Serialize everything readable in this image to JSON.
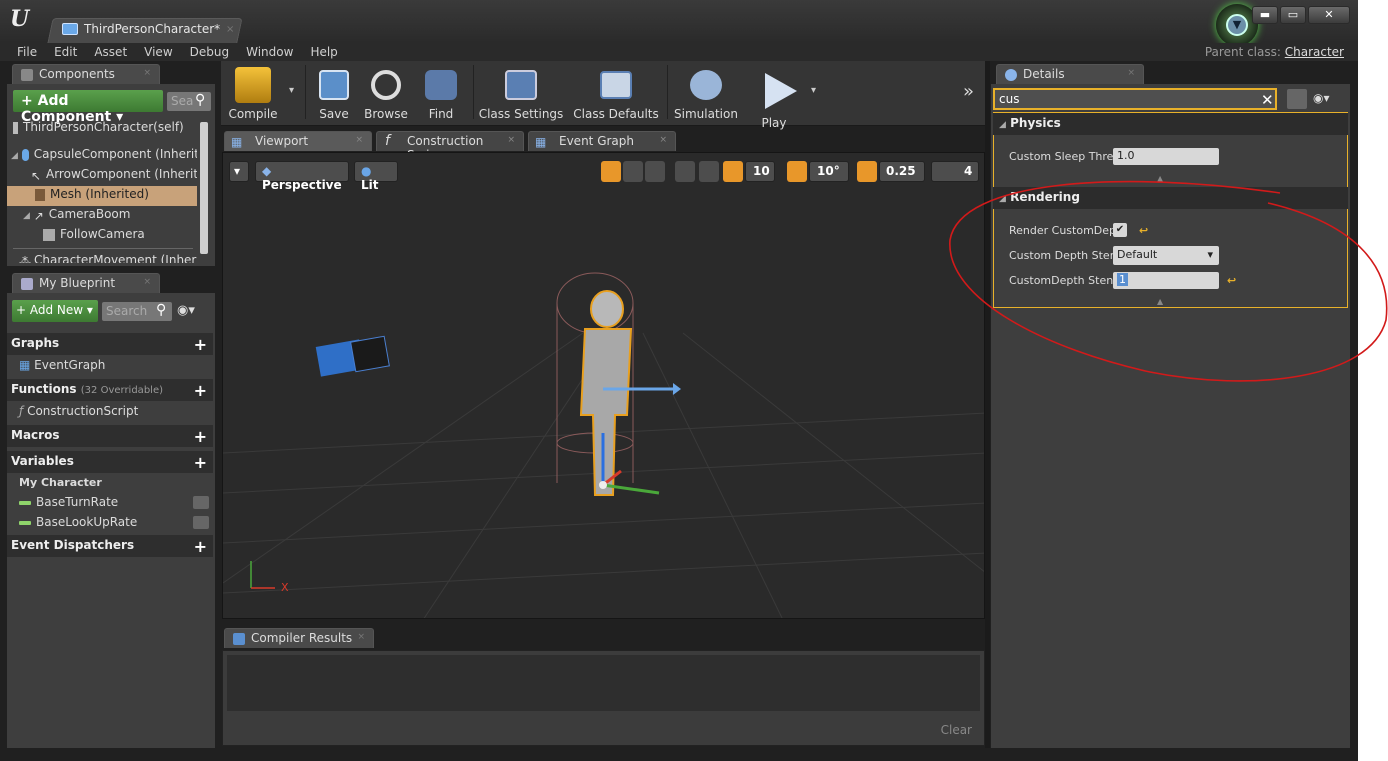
{
  "window": {
    "doc_tab": "ThirdPersonCharacter*",
    "close_glyph": "×",
    "min_glyph": "▬",
    "max_glyph": "▭",
    "x_glyph": "✕"
  },
  "menu": [
    "File",
    "Edit",
    "Asset",
    "View",
    "Debug",
    "Window",
    "Help"
  ],
  "parent_class": {
    "label": "Parent class:",
    "value": "Character"
  },
  "components": {
    "tab": "Components",
    "add_button": "+ Add Component ▾",
    "search_placeholder": "Sea",
    "items": [
      {
        "label": "ThirdPersonCharacter(self)"
      },
      {
        "label": "CapsuleComponent (Inherite"
      },
      {
        "label": "ArrowComponent (Inherite"
      },
      {
        "label": "Mesh (Inherited)"
      },
      {
        "label": "CameraBoom"
      },
      {
        "label": "FollowCamera"
      },
      {
        "label": "CharacterMovement (Inherite"
      }
    ]
  },
  "blueprint": {
    "tab": "My Blueprint",
    "add_button": "+ Add New ▾",
    "search_placeholder": "Search",
    "graphs": "Graphs",
    "event_graph": "EventGraph",
    "functions": "Functions",
    "functions_count": "(32 Overridable)",
    "construction_script": "ConstructionScript",
    "macros": "Macros",
    "variables": "Variables",
    "my_character": "My Character",
    "vars": [
      "BaseTurnRate",
      "BaseLookUpRate"
    ],
    "event_dispatchers": "Event Dispatchers"
  },
  "toolbar": {
    "compile": "Compile",
    "save": "Save",
    "browse": "Browse",
    "find": "Find",
    "class_settings": "Class Settings",
    "class_defaults": "Class Defaults",
    "simulation": "Simulation",
    "play": "Play",
    "overflow": "»"
  },
  "editor_tabs": {
    "viewport": "Viewport",
    "construction": "Construction Scrip",
    "event_graph": "Event Graph"
  },
  "viewport": {
    "perspective": "Perspective",
    "lit": "Lit",
    "grid_snap": "10",
    "rot_snap": "10°",
    "scale_snap": "0.25",
    "cam_speed": "4",
    "axis_x": "X"
  },
  "compiler": {
    "tab": "Compiler Results",
    "clear": "Clear"
  },
  "details": {
    "tab": "Details",
    "search_value": "cus",
    "physics": "Physics",
    "custom_sleep": "Custom Sleep Thres",
    "custom_sleep_value": "1.0",
    "rendering": "Rendering",
    "render_custom_depth": "Render CustomDept",
    "custom_depth_stencil_write": "Custom Depth Stenc",
    "custom_depth_stencil_write_value": "Default",
    "custom_depth_stencil_value_label": "CustomDepth Stenc",
    "custom_depth_stencil_value": "1"
  },
  "colors": {
    "accent_orange": "#e8b12a",
    "green_button": "#4a8f3f",
    "annotation_red": "#d21a1a"
  }
}
